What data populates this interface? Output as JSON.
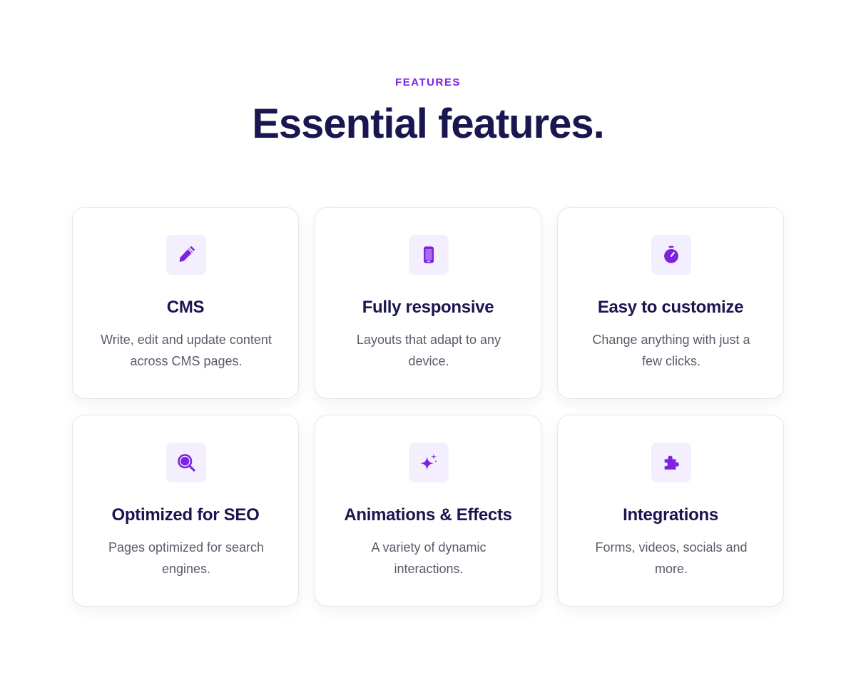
{
  "header": {
    "eyebrow": "FEATURES",
    "title": "Essential features."
  },
  "colors": {
    "accent": "#7c22e0",
    "heading": "#1a1650",
    "body_text": "#5a5a6a",
    "icon_bg": "#f3efff",
    "card_border": "#e6e6ee"
  },
  "features": [
    {
      "icon": "pencil-icon",
      "title": "CMS",
      "description": "Write, edit and update content across CMS pages."
    },
    {
      "icon": "mobile-phone-icon",
      "title": "Fully responsive",
      "description": "Layouts that adapt to any device."
    },
    {
      "icon": "stopwatch-icon",
      "title": "Easy to customize",
      "description": "Change anything with just a few clicks."
    },
    {
      "icon": "magnifier-icon",
      "title": "Optimized for SEO",
      "description": "Pages optimized for search engines."
    },
    {
      "icon": "sparkles-icon",
      "title": "Animations & Effects",
      "description": "A variety of dynamic interactions."
    },
    {
      "icon": "puzzle-piece-icon",
      "title": "Integrations",
      "description": "Forms, videos, socials and more."
    }
  ]
}
